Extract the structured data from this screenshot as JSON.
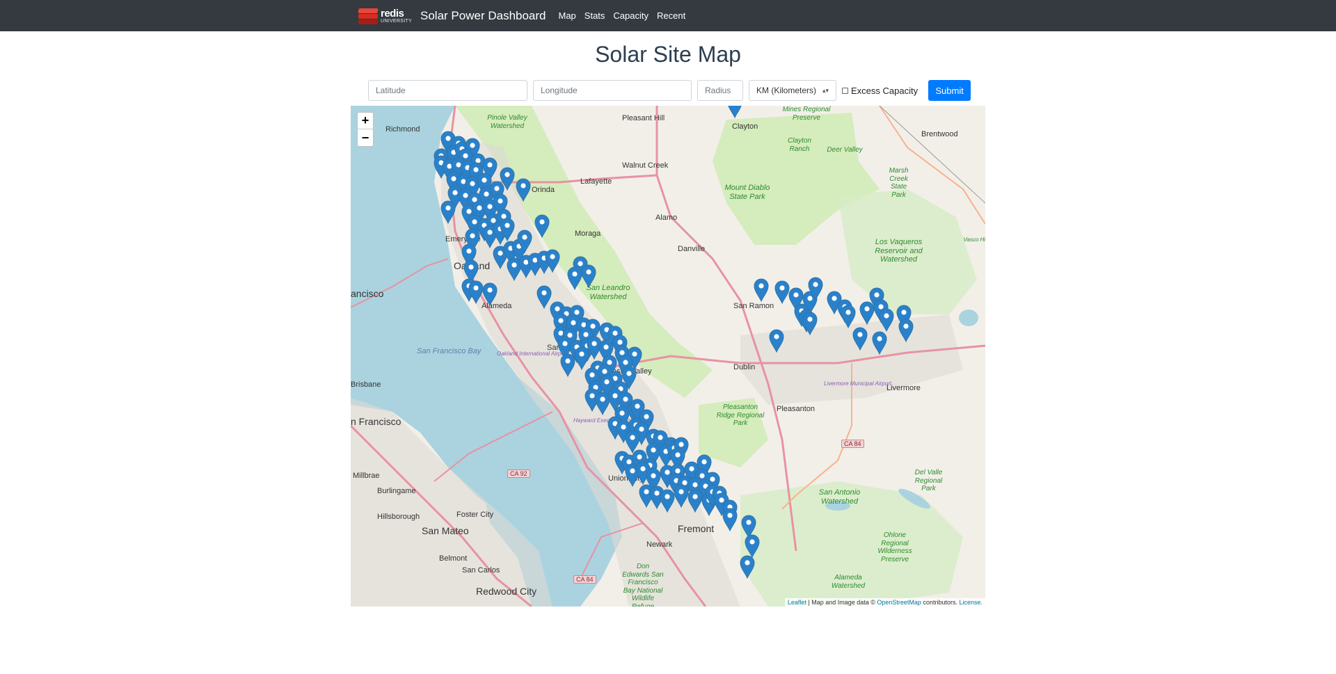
{
  "navbar": {
    "logo_line1": "redis",
    "logo_line2": "UNIVERSITY",
    "brand_title": "Solar Power Dashboard",
    "links": [
      "Map",
      "Stats",
      "Capacity",
      "Recent"
    ]
  },
  "page": {
    "title": "Solar Site Map"
  },
  "search_form": {
    "latitude_placeholder": "Latitude",
    "longitude_placeholder": "Longitude",
    "radius_placeholder": "Radius",
    "unit_selected": "KM (Kilometers)",
    "excess_capacity_label": "Excess Capacity",
    "excess_capacity_checked": false,
    "submit_label": "Submit"
  },
  "map": {
    "zoom_in": "+",
    "zoom_out": "−",
    "attribution": {
      "leaflet": "Leaflet",
      "text1": " | Map and Image data © ",
      "osm": "OpenStreetMap",
      "text2": " contributors. ",
      "license": "License."
    },
    "marker_color": "#2a81cb",
    "place_labels": {
      "richmond": "Richmond",
      "pinole": "Pinole Valley Watershed",
      "pleasant_hill": "Pleasant Hill",
      "clayton": "Clayton",
      "mines": "Mines Regional Preserve",
      "clayton_ranch": "Clayton Ranch",
      "deer_valley": "Deer Valley",
      "brentwood": "Brentwood",
      "walnut_creek": "Walnut Creek",
      "lafayette": "Lafayette",
      "orinda": "Orinda",
      "mount_diablo": "Mount Diablo State Park",
      "marsh_creek": "Marsh Creek State Park",
      "alamo": "Alamo",
      "moraga": "Moraga",
      "danville": "Danville",
      "los_vaqueros": "Los Vaqueros Reservoir and Watershed",
      "vasco_hills": "Vasco Hills",
      "oakland": "Oakland",
      "emeryville": "Emeryville",
      "san_leandro_ws": "San Leandro Watershed",
      "san_ramon": "San Ramon",
      "san_francisco_short": "ancisco",
      "alameda": "Alameda",
      "sf_bay": "San Francisco Bay",
      "oakland_airport": "Oakland International Airport",
      "san_leandro": "San Leandro",
      "castro_valley": "Castro Valley",
      "dublin": "Dublin",
      "livermore": "Livermore",
      "livermore_airport": "Livermore Municipal Airport",
      "pleasanton": "Pleasanton",
      "brisbane": "Brisbane",
      "pleasanton_ridge": "Pleasanton Ridge Regional Park",
      "san_francisco": "n Francisco",
      "hayward_airport": "Hayward Executive Airport",
      "millbrae": "Millbrae",
      "burlingame": "Burlingame",
      "hillsborough": "Hillsborough",
      "foster_city": "Foster City",
      "san_mateo": "San Mateo",
      "belmont": "Belmont",
      "san_carlos": "San Carlos",
      "redwood_city": "Redwood City",
      "union_city": "Union City",
      "newark": "Newark",
      "fremont": "Fremont",
      "don_edwards": "Don Edwards San Francisco Bay National Wildlife Refuge",
      "san_antonio": "San Antonio Watershed",
      "del_valle": "Del Valle Regional Park",
      "ohlone": "Ohlone Regional Wilderness Preserve",
      "alameda_ws": "Alameda Watershed"
    },
    "shields": [
      "CA 92",
      "CA 84",
      "CA 84"
    ]
  }
}
